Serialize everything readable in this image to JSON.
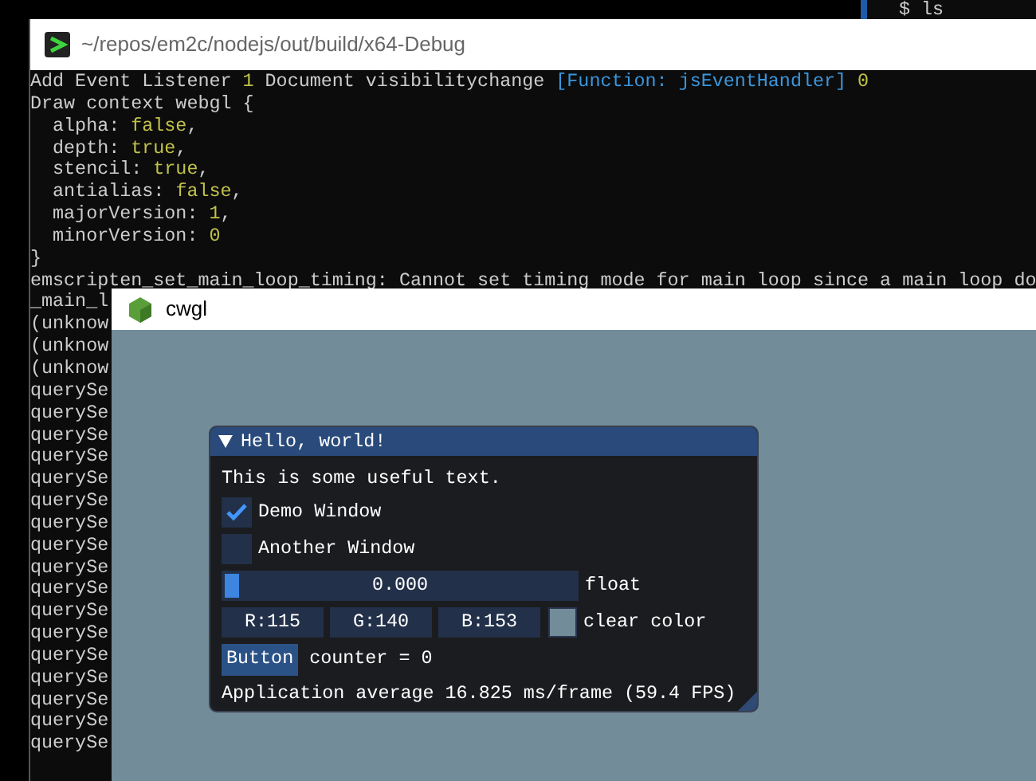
{
  "background_terminal": {
    "lines": [
      "$ ls"
    ]
  },
  "terminal": {
    "title": "~/repos/em2c/nodejs/out/build/x64-Debug",
    "lines": [
      {
        "segments": [
          {
            "kind": "plain",
            "text": "Add Event Listener "
          },
          {
            "kind": "value",
            "text": "1"
          },
          {
            "kind": "plain",
            "text": " Document visibilitychange "
          },
          {
            "kind": "function",
            "text": "[Function: jsEventHandler] "
          },
          {
            "kind": "value",
            "text": "0"
          }
        ]
      },
      {
        "segments": [
          {
            "kind": "plain",
            "text": "Draw context webgl {"
          }
        ]
      },
      {
        "segments": [
          {
            "kind": "plain",
            "text": "  alpha: "
          },
          {
            "kind": "value",
            "text": "false"
          },
          {
            "kind": "plain",
            "text": ","
          }
        ]
      },
      {
        "segments": [
          {
            "kind": "plain",
            "text": "  depth: "
          },
          {
            "kind": "value",
            "text": "true"
          },
          {
            "kind": "plain",
            "text": ","
          }
        ]
      },
      {
        "segments": [
          {
            "kind": "plain",
            "text": "  stencil: "
          },
          {
            "kind": "value",
            "text": "true"
          },
          {
            "kind": "plain",
            "text": ","
          }
        ]
      },
      {
        "segments": [
          {
            "kind": "plain",
            "text": "  antialias: "
          },
          {
            "kind": "value",
            "text": "false"
          },
          {
            "kind": "plain",
            "text": ","
          }
        ]
      },
      {
        "segments": [
          {
            "kind": "plain",
            "text": "  majorVersion: "
          },
          {
            "kind": "value",
            "text": "1"
          },
          {
            "kind": "plain",
            "text": ","
          }
        ]
      },
      {
        "segments": [
          {
            "kind": "plain",
            "text": "  minorVersion: "
          },
          {
            "kind": "value",
            "text": "0"
          }
        ]
      },
      {
        "segments": [
          {
            "kind": "plain",
            "text": "}"
          }
        ]
      },
      {
        "segments": [
          {
            "kind": "plain",
            "text": "emscripten_set_main_loop_timing: Cannot set timing mode for main loop since a main loop do"
          }
        ]
      },
      {
        "segments": [
          {
            "kind": "plain",
            "text": "_main_l"
          }
        ]
      },
      {
        "segments": [
          {
            "kind": "plain",
            "text": "(unknow"
          }
        ]
      },
      {
        "segments": [
          {
            "kind": "plain",
            "text": "(unknow"
          }
        ]
      },
      {
        "segments": [
          {
            "kind": "plain",
            "text": "(unknow"
          }
        ]
      },
      {
        "segments": [
          {
            "kind": "plain",
            "text": "querySe"
          }
        ]
      },
      {
        "segments": [
          {
            "kind": "plain",
            "text": "querySe"
          }
        ]
      },
      {
        "segments": [
          {
            "kind": "plain",
            "text": "querySe"
          }
        ]
      },
      {
        "segments": [
          {
            "kind": "plain",
            "text": "querySe"
          }
        ]
      },
      {
        "segments": [
          {
            "kind": "plain",
            "text": "querySe"
          }
        ]
      },
      {
        "segments": [
          {
            "kind": "plain",
            "text": "querySe"
          }
        ]
      },
      {
        "segments": [
          {
            "kind": "plain",
            "text": "querySe"
          }
        ]
      },
      {
        "segments": [
          {
            "kind": "plain",
            "text": "querySe"
          }
        ]
      },
      {
        "segments": [
          {
            "kind": "plain",
            "text": "querySe"
          }
        ]
      },
      {
        "segments": [
          {
            "kind": "plain",
            "text": "querySe"
          }
        ]
      },
      {
        "segments": [
          {
            "kind": "plain",
            "text": "querySe"
          }
        ]
      },
      {
        "segments": [
          {
            "kind": "plain",
            "text": "querySe"
          }
        ]
      },
      {
        "segments": [
          {
            "kind": "plain",
            "text": "querySe"
          }
        ]
      },
      {
        "segments": [
          {
            "kind": "plain",
            "text": "querySe"
          }
        ]
      },
      {
        "segments": [
          {
            "kind": "plain",
            "text": "querySe"
          }
        ]
      },
      {
        "segments": [
          {
            "kind": "plain",
            "text": "querySe"
          }
        ]
      },
      {
        "segments": [
          {
            "kind": "plain",
            "text": "querySe"
          }
        ]
      }
    ]
  },
  "app_window": {
    "title": "cwgl",
    "imgui": {
      "title": "Hello, world!",
      "expanded": true,
      "text": "This is some useful text.",
      "checkboxes": [
        {
          "label": "Demo Window",
          "checked": true
        },
        {
          "label": "Another Window",
          "checked": false
        }
      ],
      "slider": {
        "value": "0.000",
        "label": "float",
        "level": 0
      },
      "color_edit": {
        "channels": [
          "R:115",
          "G:140",
          "B:153"
        ],
        "color": "#738c99",
        "label": "clear color"
      },
      "button": "Button",
      "counter": "counter = 0",
      "stats": "Application average 16.825 ms/frame (59.4 FPS)"
    }
  }
}
